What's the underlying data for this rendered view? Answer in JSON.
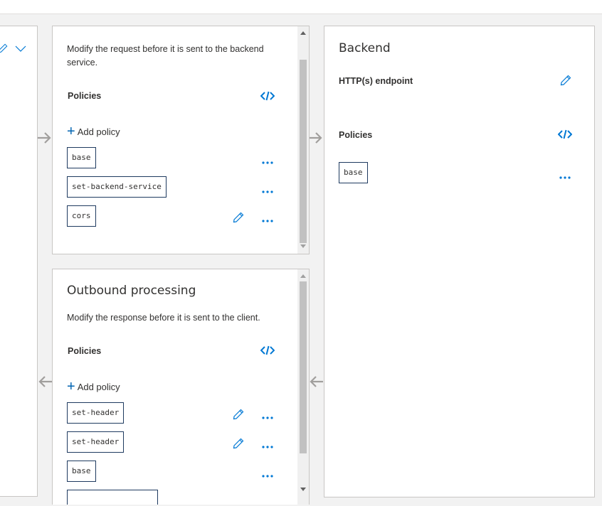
{
  "inbound": {
    "description": "Modify the request before it is sent to the backend service.",
    "policies_label": "Policies",
    "add_policy_label": "Add policy",
    "policies": [
      "base",
      "set-backend-service",
      "cors"
    ]
  },
  "outbound": {
    "title": "Outbound processing",
    "description": "Modify the response before it is sent to the client.",
    "policies_label": "Policies",
    "add_policy_label": "Add policy",
    "policies": [
      "set-header",
      "set-header",
      "base"
    ]
  },
  "backend": {
    "title": "Backend",
    "endpoint_label": "HTTP(s) endpoint",
    "policies_label": "Policies",
    "policies": [
      "base"
    ]
  },
  "colors": {
    "accent": "#0078d4",
    "chip_border": "#1e3a5f",
    "arrow": "#a19f9d"
  },
  "icons": [
    "code-view-icon",
    "edit-pencil-icon",
    "more-options-icon",
    "plus-icon",
    "chevron-down-icon",
    "flow-arrow-icon"
  ]
}
